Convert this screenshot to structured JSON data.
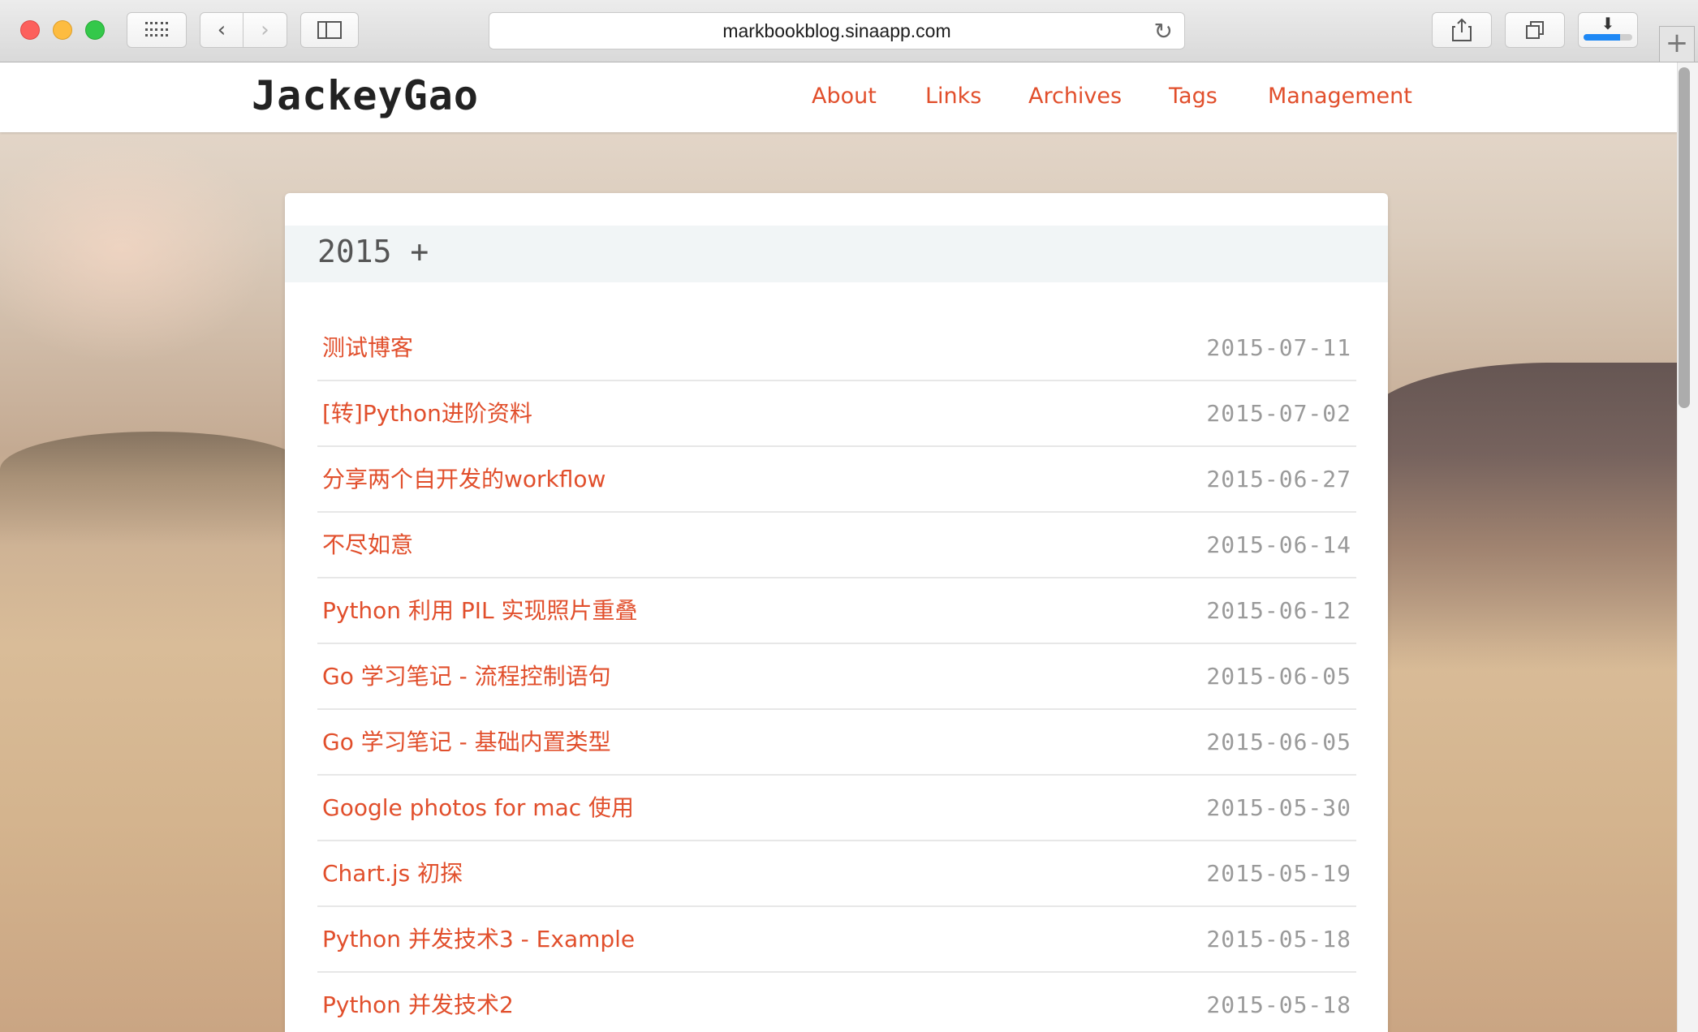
{
  "browser": {
    "url": "markbookblog.sinaapp.com",
    "download_progress": 0.75,
    "icons": {
      "grid": "grid-icon",
      "back": "chevron-left-icon",
      "forward": "chevron-right-icon",
      "sidebar": "sidebar-icon",
      "reload": "reload-icon",
      "share": "share-icon",
      "tabs": "tabs-icon",
      "download": "download-icon",
      "new_tab": "plus-icon"
    }
  },
  "site": {
    "title": "JackeyGao",
    "nav": [
      "About",
      "Links",
      "Archives",
      "Tags",
      "Management"
    ],
    "accent_color": "#e14f2c"
  },
  "archive": {
    "year_label": "2015 +",
    "posts": [
      {
        "title": "测试博客",
        "date": "2015-07-11"
      },
      {
        "title": "[转]Python进阶资料",
        "date": "2015-07-02"
      },
      {
        "title": "分享两个自开发的workflow",
        "date": "2015-06-27"
      },
      {
        "title": "不尽如意",
        "date": "2015-06-14"
      },
      {
        "title": "Python 利用 PIL 实现照片重叠",
        "date": "2015-06-12"
      },
      {
        "title": "Go 学习笔记 - 流程控制语句",
        "date": "2015-06-05"
      },
      {
        "title": "Go 学习笔记 - 基础内置类型",
        "date": "2015-06-05"
      },
      {
        "title": "Google photos for mac 使用",
        "date": "2015-05-30"
      },
      {
        "title": "Chart.js 初探",
        "date": "2015-05-19"
      },
      {
        "title": "Python 并发技术3 - Example",
        "date": "2015-05-18"
      },
      {
        "title": "Python 并发技术2",
        "date": "2015-05-18"
      }
    ]
  }
}
